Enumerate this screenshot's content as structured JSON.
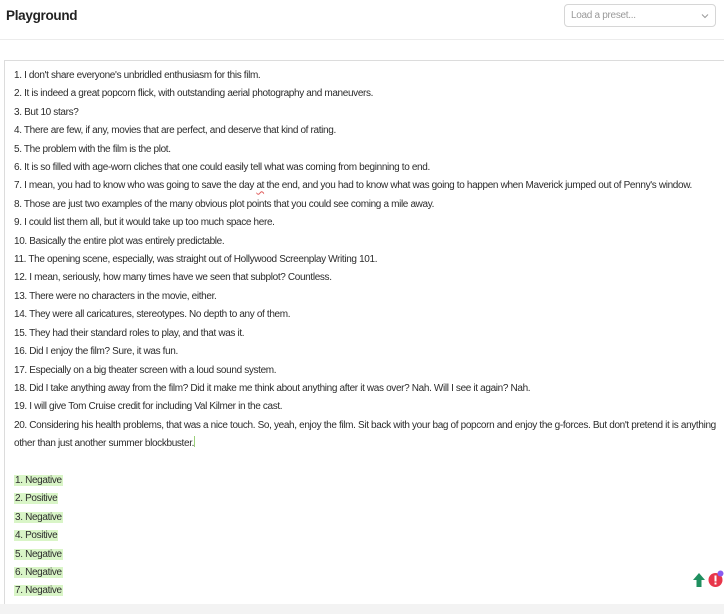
{
  "header": {
    "title": "Playground",
    "preset_placeholder": "Load a preset..."
  },
  "editor": {
    "lines": [
      "1. I don't share everyone's unbridled enthusiasm for this film.",
      "2. It is indeed a great popcorn flick, with outstanding aerial photography and maneuvers.",
      "3. But 10 stars?",
      "4. There are few, if any, movies that are perfect, and deserve that kind of rating.",
      "5. The problem with the film is the plot.",
      "6. It is so filled with age-worn cliches that one could easily tell what was coming from beginning to end.",
      "7. I mean, you had to know who was going to save the day at the end, and you had to know what was going to happen when Maverick jumped out of Penny's window.",
      "8. Those are just two examples of the many obvious plot points that you could see coming a mile away.",
      "9. I could list them all, but it would take up too much space here.",
      "10. Basically the entire plot was entirely predictable.",
      "11. The opening scene, especially, was straight out of Hollywood Screenplay Writing 101.",
      "12. I mean, seriously, how many times have we seen that subplot? Countless.",
      "13. There were no characters in the movie, either.",
      "14. They were all caricatures, stereotypes. No depth to any of them.",
      "15. They had their standard roles to play, and that was it.",
      "16. Did I enjoy the film? Sure, it was fun.",
      "17. Especially on a big theater screen with a loud sound system.",
      "18. Did I take anything away from the film? Did it make me think about anything after it was over? Nah. Will I see it again? Nah.",
      "19. I will give Tom Cruise credit for including Val Kilmer in the cast.",
      "20. Considering his health problems, that was a nice touch. So, yeah, enjoy the film. Sit back with your bag of popcorn and enjoy the g-forces. But don't pretend it is anything other than just another summer blockbuster."
    ],
    "line7_parts": {
      "before": "7. I mean, you had to know who was going to save the day ",
      "flagged": "at",
      "after": " the end, and you had to know what was going to happen when Maverick jumped out of Penny's window."
    },
    "results": [
      "1. Negative",
      "2. Positive",
      "3. Negative",
      "4. Positive",
      "5. Negative",
      "6. Negative",
      "7. Negative"
    ]
  },
  "colors": {
    "highlight": "#d9f5c7",
    "fab_green": "#1f8f5f",
    "badge_red": "#e8354a"
  },
  "icons": {
    "preset_dropdown": "chevron-down-icon",
    "scroll_top": "arrow-up-icon",
    "notification": "notification-badge-icon"
  }
}
